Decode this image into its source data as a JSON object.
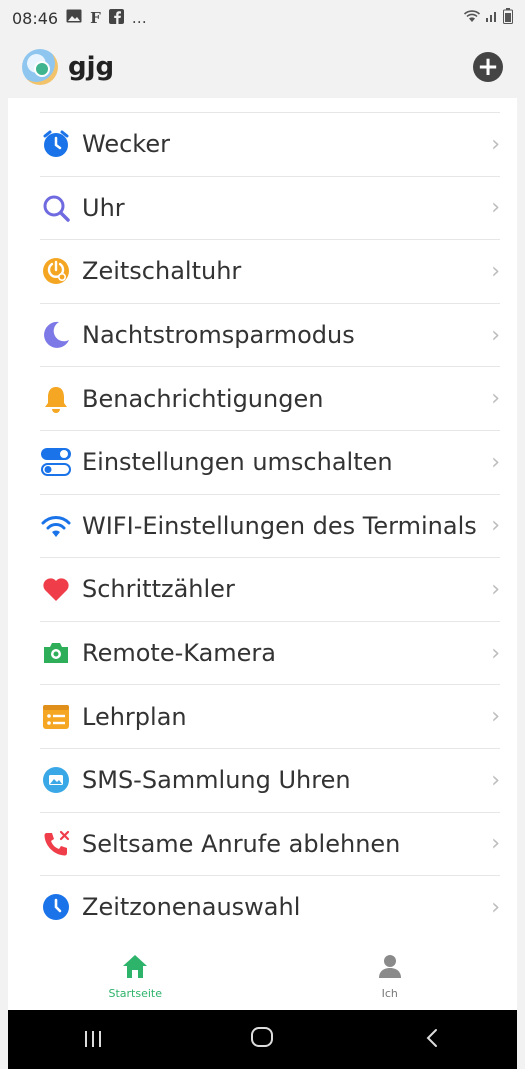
{
  "status_bar": {
    "time": "08:46",
    "icons_left": [
      "image-icon",
      "flipboard-icon",
      "facebook-icon",
      "more-icon"
    ],
    "more": "…",
    "icons_right": [
      "wifi-icon",
      "signal-icon",
      "battery-icon"
    ]
  },
  "header": {
    "title": "gjg",
    "add_label": "+"
  },
  "menu": {
    "items": [
      {
        "label": "Wecker",
        "icon": "alarm-clock-icon",
        "color": "#1a73e8"
      },
      {
        "label": "Uhr",
        "icon": "search-icon",
        "color": "#6f6ae0"
      },
      {
        "label": "Zeitschaltuhr",
        "icon": "timer-icon",
        "color": "#f4a623"
      },
      {
        "label": "Nachtstromsparmodus",
        "icon": "moon-icon",
        "color": "#7d79e6"
      },
      {
        "label": "Benachrichtigungen",
        "icon": "bell-icon",
        "color": "#f5a623"
      },
      {
        "label": "Einstellungen umschalten",
        "icon": "toggle-icon",
        "color": "#1a73e8"
      },
      {
        "label": "WIFI-Einstellungen des Terminals",
        "icon": "wifi-icon",
        "color": "#1a73e8"
      },
      {
        "label": "Schrittzähler",
        "icon": "heart-icon",
        "color": "#ef3e4a"
      },
      {
        "label": "Remote-Kamera",
        "icon": "camera-icon",
        "color": "#2fae5a"
      },
      {
        "label": "Lehrplan",
        "icon": "schedule-icon",
        "color": "#f5a623"
      },
      {
        "label": "SMS-Sammlung Uhren",
        "icon": "message-icon",
        "color": "#3aa8e6"
      },
      {
        "label": "Seltsame Anrufe ablehnen",
        "icon": "blocked-call-icon",
        "color": "#ef3e4a"
      },
      {
        "label": "Zeitzonenauswahl",
        "icon": "clock-icon",
        "color": "#1a73e8"
      }
    ]
  },
  "tabbar": {
    "tabs": [
      {
        "label": "Startseite",
        "icon": "home-icon",
        "active": true
      },
      {
        "label": "Ich",
        "icon": "person-icon",
        "active": false
      }
    ]
  },
  "colors": {
    "accent": "#2db36a",
    "chevron": "#bdbdbd"
  }
}
